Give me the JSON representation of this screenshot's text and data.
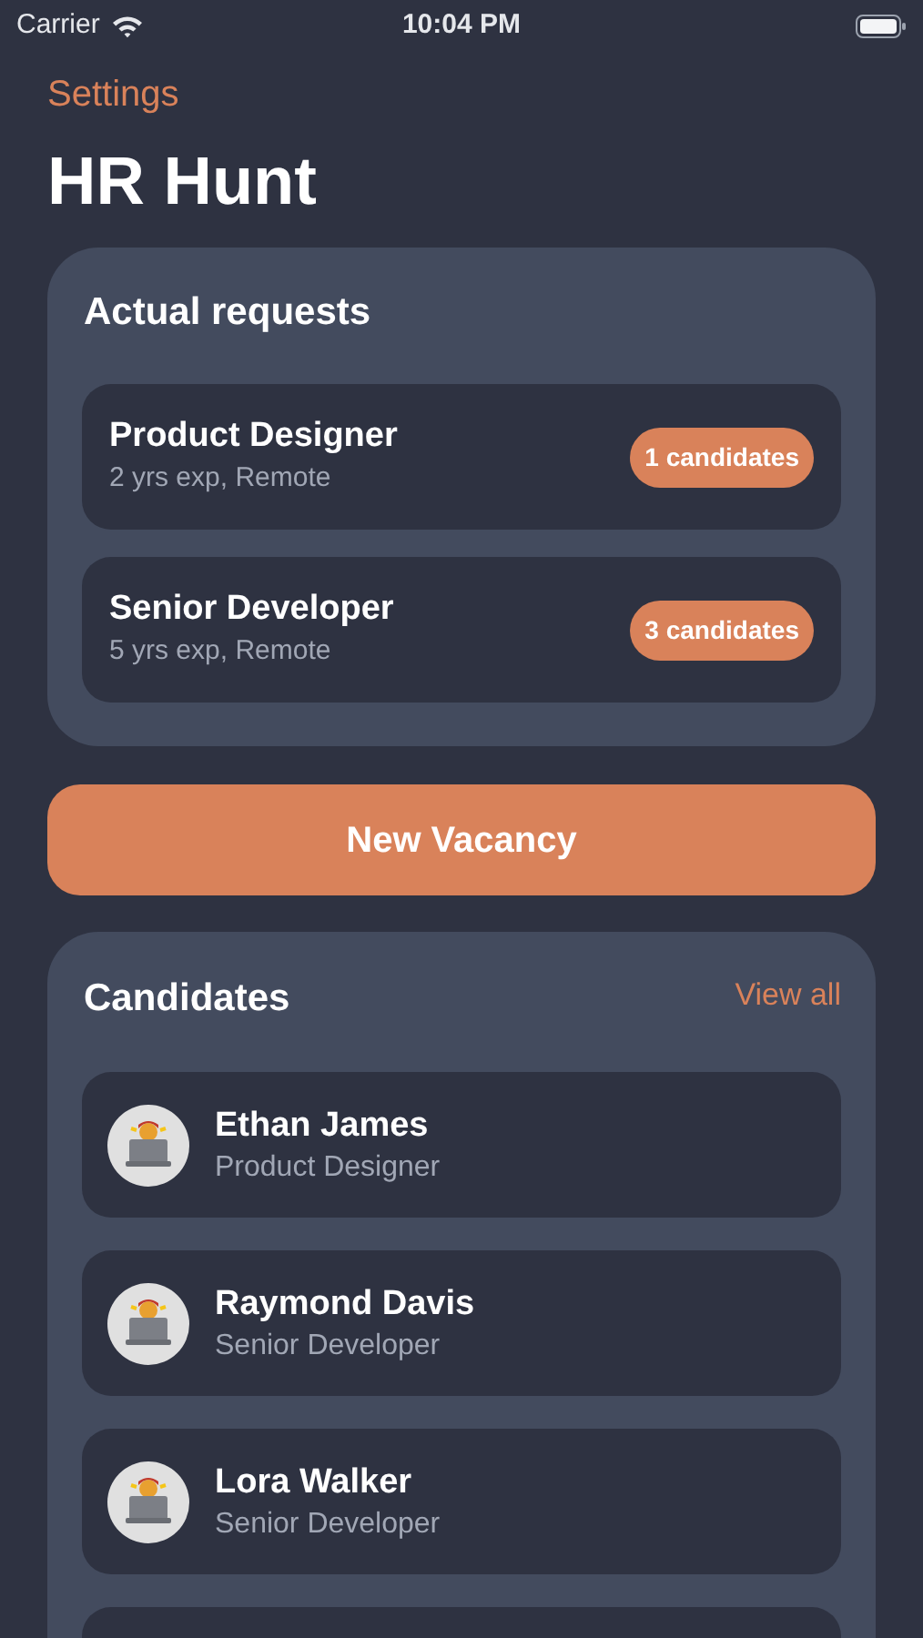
{
  "status_bar": {
    "carrier": "Carrier",
    "time": "10:04 PM"
  },
  "nav": {
    "back_label": "Settings",
    "title": "HR Hunt"
  },
  "requests": {
    "title": "Actual requests",
    "items": [
      {
        "title": "Product Designer",
        "subtitle": "2 yrs exp, Remote",
        "badge": "1 candidates"
      },
      {
        "title": "Senior Developer",
        "subtitle": "5 yrs exp, Remote",
        "badge": "3 candidates"
      }
    ]
  },
  "new_vacancy_button": "New Vacancy",
  "candidates": {
    "title": "Candidates",
    "view_all": "View all",
    "items": [
      {
        "kind": "candidate",
        "name": "Ethan James",
        "role": "Product Designer"
      },
      {
        "kind": "candidate",
        "name": "Raymond Davis",
        "role": "Senior Developer"
      },
      {
        "kind": "candidate",
        "name": "Lora Walker",
        "role": "Senior Developer"
      },
      {
        "kind": "partial"
      }
    ]
  }
}
